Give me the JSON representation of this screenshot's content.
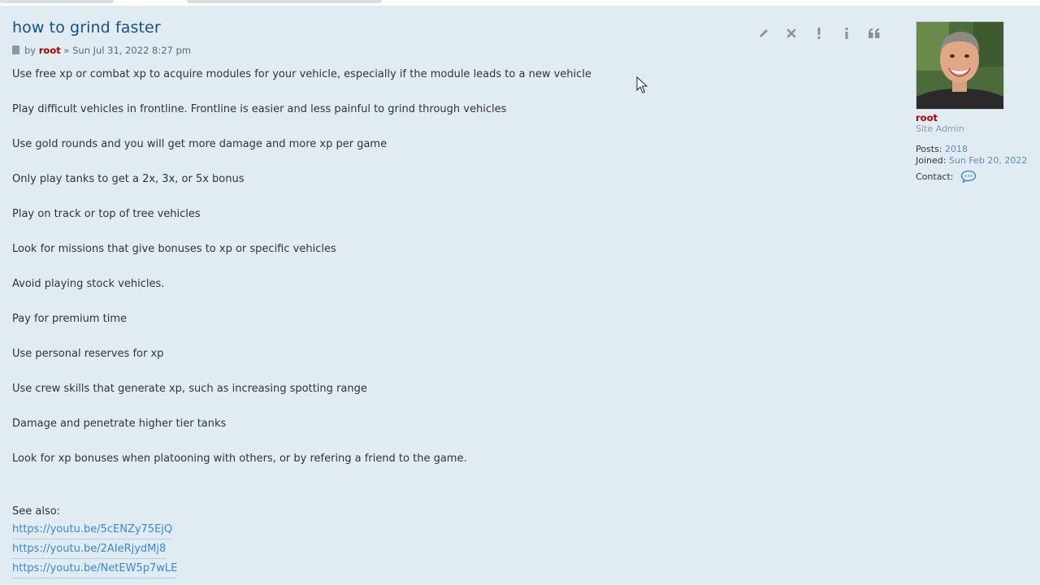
{
  "post": {
    "title": "how to grind faster",
    "meta": {
      "by_label": "by",
      "author": "root",
      "separator": "»",
      "date": "Sun Jul 31, 2022 8:27 pm"
    },
    "paragraphs": [
      "Use free xp or combat xp to acquire modules for your vehicle, especially if the module leads to a new vehicle",
      "Play difficult vehicles in frontline. Frontline is easier and less painful to grind through vehicles",
      "Use gold rounds and you will get more damage and more xp per game",
      "Only play tanks to get a 2x, 3x, or 5x bonus",
      "Play on track or top of tree vehicles",
      "Look for missions that give bonuses to xp or specific vehicles",
      "Avoid playing stock vehicles.",
      "Pay for premium time",
      "Use personal reserves for xp",
      "Use crew skills that generate xp, such as increasing spotting range",
      "Damage and penetrate higher tier tanks",
      "Look for xp bonuses when platooning with others, or by refering a friend to the game."
    ],
    "see_also_label": "See also:",
    "links": [
      "https://youtu.be/5cENZy75EjQ",
      "https://youtu.be/2AIeRjydMj8",
      "https://youtu.be/NetEW5p7wLE"
    ],
    "actions": [
      {
        "name": "edit",
        "icon": "pencil-icon"
      },
      {
        "name": "delete",
        "icon": "close-icon"
      },
      {
        "name": "report",
        "icon": "exclamation-icon"
      },
      {
        "name": "info",
        "icon": "info-icon"
      },
      {
        "name": "quote",
        "icon": "quote-icon"
      }
    ]
  },
  "profile": {
    "username": "root",
    "rank": "Site Admin",
    "posts_label": "Posts:",
    "posts_value": "2018",
    "joined_label": "Joined:",
    "joined_value": "Sun Feb 20, 2022",
    "contact_label": "Contact:"
  },
  "colors": {
    "background": "#e1ebf2",
    "title": "#105289",
    "author": "#aa0000",
    "link": "#368ad2"
  }
}
